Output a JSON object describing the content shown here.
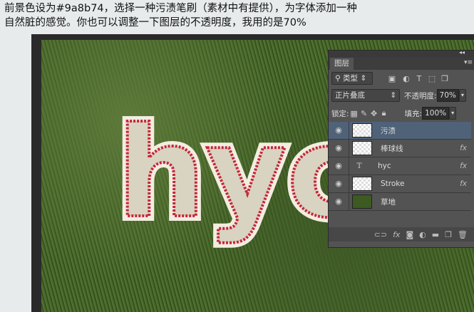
{
  "caption": {
    "line1": "前景色设为#9a8b74，选择一种污渍笔刷（素材中有提供），为字体添加一种",
    "line2": "自然脏的感觉。你也可以调整一下图层的不透明度，我用的是70%"
  },
  "canvas_text": "hyc",
  "panel": {
    "tab": "图层",
    "filter_kind": "类型",
    "blend_mode": "正片叠底",
    "opacity_label": "不透明度:",
    "opacity_value": "70%",
    "lock_label": "锁定:",
    "fill_label": "填充:",
    "fill_value": "100%",
    "layers": [
      {
        "name": "污渍",
        "type": "pixel",
        "selected": true,
        "fx": false
      },
      {
        "name": "棒球线",
        "type": "pixel",
        "fx": true
      },
      {
        "name": "hyc",
        "type": "text",
        "fx": true
      },
      {
        "name": "Stroke",
        "type": "pixel",
        "fx": true
      },
      {
        "name": "草地",
        "type": "grass",
        "fx": false
      }
    ],
    "fx_label": "fx"
  },
  "colors": {
    "panel": "#535353",
    "selected": "#4f6278",
    "foreground": "#9a8b74"
  }
}
